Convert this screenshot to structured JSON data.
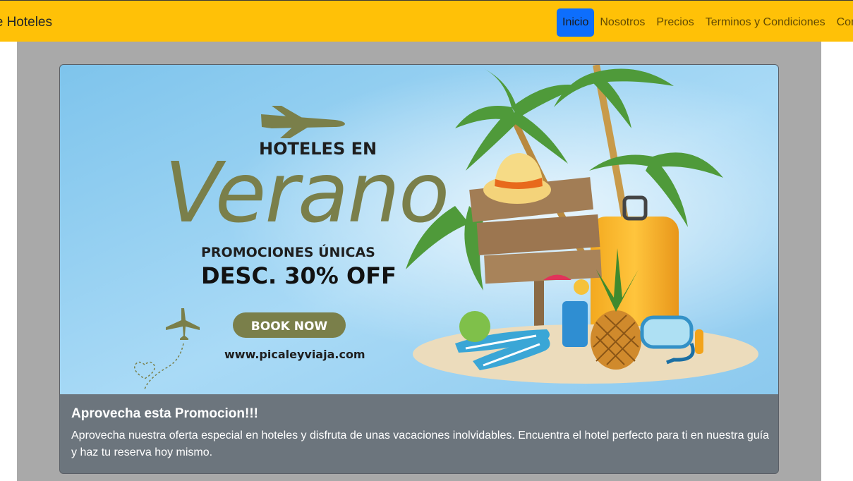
{
  "navbar": {
    "brand": "e Hoteles",
    "links": [
      {
        "label": "Inicio",
        "active": true
      },
      {
        "label": "Nosotros",
        "active": false
      },
      {
        "label": "Precios",
        "active": false
      },
      {
        "label": "Terminos y Condiciones",
        "active": false
      },
      {
        "label": "Con",
        "active": false
      }
    ],
    "bg_color": "#ffc107",
    "active_color": "#0d6efd"
  },
  "card": {
    "banner": {
      "heading": "HOTELES EN",
      "script_word": "Verano",
      "promo_line": "PROMOCIONES ÚNICAS",
      "discount": "DESC. 30% OFF",
      "cta": "BOOK NOW",
      "website": "www.picaleyviaja.com",
      "accent_color": "#7a7f4a"
    },
    "title": "Aprovecha esta Promocion!!!",
    "text": "Aprovecha nuestra oferta especial en hoteles y disfruta de unas vacaciones inolvidables. Encuentra el hotel perfecto para ti en nuestra guía y haz tu reserva hoy mismo.",
    "body_color": "#6c757d"
  }
}
